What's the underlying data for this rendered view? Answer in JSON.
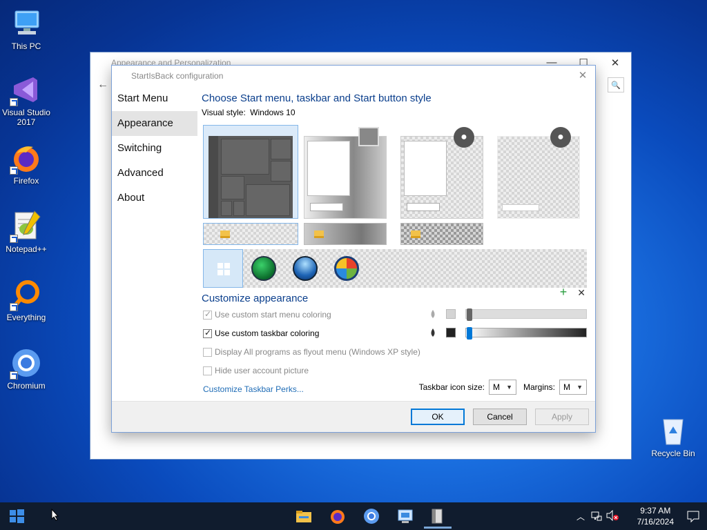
{
  "desktop": {
    "icons": [
      {
        "label": "This PC"
      },
      {
        "label": "Visual Studio 2017"
      },
      {
        "label": "Firefox"
      },
      {
        "label": "Notepad++"
      },
      {
        "label": "Everything"
      },
      {
        "label": "Chromium"
      },
      {
        "label": "Recycle Bin"
      }
    ]
  },
  "bg_window": {
    "title": "Appearance and Personalization",
    "minimize": "—",
    "maximize": "☐",
    "close": "✕",
    "back": "←",
    "search_icon": "🔍"
  },
  "dialog": {
    "title": "StartIsBack configuration",
    "close": "✕",
    "nav": [
      "Start Menu",
      "Appearance",
      "Switching",
      "Advanced",
      "About"
    ],
    "active_nav": "Appearance",
    "heading": "Choose Start menu, taskbar and Start button style",
    "visual_style_label": "Visual style:",
    "visual_style_value": "Windows 10",
    "customize_heading": "Customize appearance",
    "add_icon": "+",
    "remove_icon": "✕",
    "options": [
      {
        "label": "Use custom start menu coloring",
        "checked": true,
        "disabled": true
      },
      {
        "label": "Use custom taskbar coloring",
        "checked": true,
        "disabled": false
      },
      {
        "label": "Display All programs as flyout menu (Windows XP style)",
        "checked": false,
        "disabled": true
      },
      {
        "label": "Hide user account picture",
        "checked": false,
        "disabled": true
      }
    ],
    "start_menu_color": {
      "swatch": "#d4d4d4",
      "slider_value": 0
    },
    "taskbar_color": {
      "swatch": "#222222",
      "slider_value": 0
    },
    "link": "Customize Taskbar Perks...",
    "taskbar_icon_size_label": "Taskbar icon size:",
    "taskbar_icon_size": "M",
    "margins_label": "Margins:",
    "margins": "M",
    "buttons": {
      "ok": "OK",
      "cancel": "Cancel",
      "apply": "Apply"
    }
  },
  "taskbar": {
    "time": "9:37 AM",
    "date": "7/16/2024"
  },
  "colors": {
    "accent": "#0078d7",
    "heading": "#0a3e8c",
    "link": "#1f6cb6"
  }
}
